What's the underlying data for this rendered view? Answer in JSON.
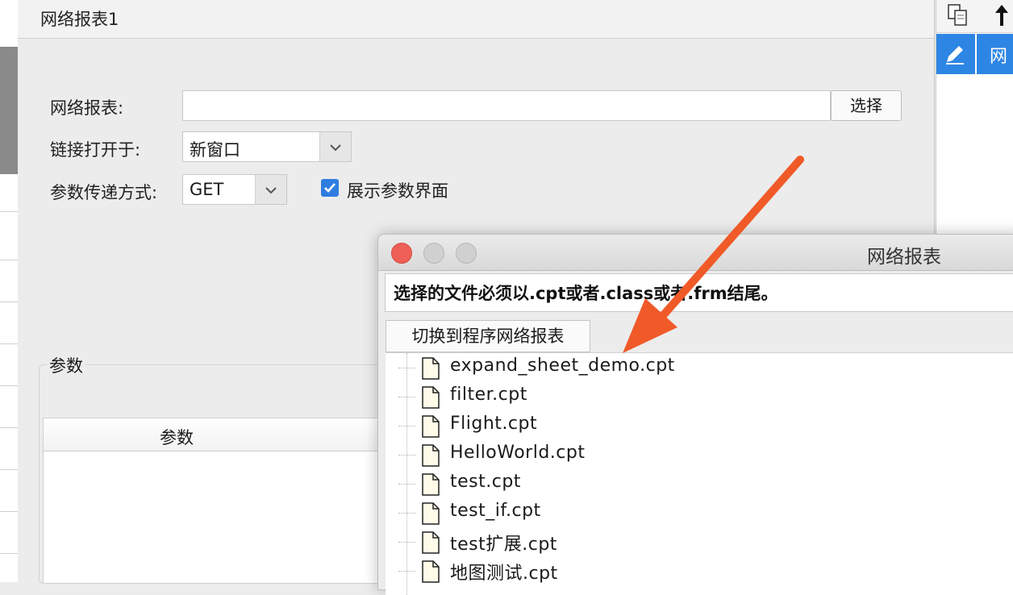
{
  "main_dialog": {
    "title": "网络报表1",
    "report_label": "网络报表:",
    "report_value": "",
    "select_button": "选择",
    "link_label": "链接打开于:",
    "link_value": "新窗口",
    "method_label": "参数传递方式:",
    "method_value": "GET",
    "show_params_label": "展示参数界面",
    "show_params_checked": true,
    "params_group_label": "参数",
    "params_column_header": "参数"
  },
  "right_panel": {
    "row_text": "网",
    "toolbar_icons": [
      "copy-icon",
      "up-arrow-icon"
    ],
    "row_icon": "pencil-icon",
    "row_color": "#2e86e4"
  },
  "file_dialog": {
    "title": "网络报表",
    "instruction": "选择的文件必须以.cpt或者.class或者.frm结尾。",
    "switch_button": "切换到程序网络报表",
    "files": [
      "expand_sheet_demo.cpt",
      "filter.cpt",
      "Flight.cpt",
      "HelloWorld.cpt",
      "test.cpt",
      "test_if.cpt",
      "test扩展.cpt",
      "地图测试.cpt"
    ]
  },
  "colors": {
    "accent_blue": "#2f7de1",
    "annotation_orange": "#f05a28",
    "close_red": "#ed5f57"
  }
}
